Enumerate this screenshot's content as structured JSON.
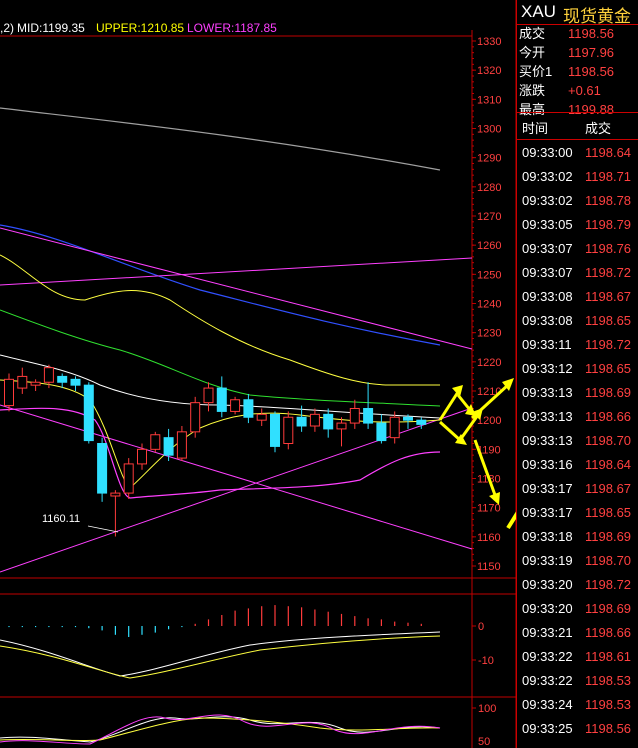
{
  "header": {
    "period_prefix": ",2)",
    "mid": "MID:1199.35",
    "upper": "UPPER:1210.85",
    "lower": "LOWER:1187.85"
  },
  "colors": {
    "up": "#ff3b3b",
    "down": "#30e0ff",
    "mid": "#ffffff",
    "upper": "#ffff00",
    "lower": "#ff00ff",
    "axis": "#c00000",
    "text_red": "#ff4040",
    "arrow": "#ffff00"
  },
  "symbol": {
    "code": "XAU",
    "name": "现货黄金"
  },
  "quote": [
    {
      "label": "成交",
      "value": "1198.56"
    },
    {
      "label": "今开",
      "value": "1197.96"
    },
    {
      "label": "买价1",
      "value": "1198.56"
    },
    {
      "label": "涨跌",
      "value": "+0.61"
    },
    {
      "label": "最高",
      "value": "1199.88"
    }
  ],
  "ticks_header": {
    "time": "时间",
    "price": "成交"
  },
  "ticks": [
    {
      "time": "09:33:00",
      "price": "1198.64"
    },
    {
      "time": "09:33:02",
      "price": "1198.71"
    },
    {
      "time": "09:33:02",
      "price": "1198.78"
    },
    {
      "time": "09:33:05",
      "price": "1198.79"
    },
    {
      "time": "09:33:07",
      "price": "1198.76"
    },
    {
      "time": "09:33:07",
      "price": "1198.72"
    },
    {
      "time": "09:33:08",
      "price": "1198.67"
    },
    {
      "time": "09:33:08",
      "price": "1198.65"
    },
    {
      "time": "09:33:11",
      "price": "1198.72"
    },
    {
      "time": "09:33:12",
      "price": "1198.65"
    },
    {
      "time": "09:33:13",
      "price": "1198.69"
    },
    {
      "time": "09:33:13",
      "price": "1198.66"
    },
    {
      "time": "09:33:13",
      "price": "1198.70"
    },
    {
      "time": "09:33:16",
      "price": "1198.64"
    },
    {
      "time": "09:33:17",
      "price": "1198.67"
    },
    {
      "time": "09:33:17",
      "price": "1198.65"
    },
    {
      "time": "09:33:18",
      "price": "1198.69"
    },
    {
      "time": "09:33:19",
      "price": "1198.70"
    },
    {
      "time": "09:33:20",
      "price": "1198.72"
    },
    {
      "time": "09:33:20",
      "price": "1198.69"
    },
    {
      "time": "09:33:21",
      "price": "1198.66"
    },
    {
      "time": "09:33:22",
      "price": "1198.61"
    },
    {
      "time": "09:33:22",
      "price": "1198.53"
    },
    {
      "time": "09:33:24",
      "price": "1198.53"
    },
    {
      "time": "09:33:25",
      "price": "1198.56"
    }
  ],
  "main_axis": {
    "labels": [
      "1330",
      "1320",
      "1310",
      "1300",
      "1290",
      "1280",
      "1270",
      "1260",
      "1250",
      "1240",
      "1230",
      "1220",
      "1210",
      "1200",
      "1190",
      "1180",
      "1170",
      "1160",
      "1150"
    ],
    "min": 1150,
    "max": 1330
  },
  "low_annotation": "1160.11",
  "macd_axis": {
    "labels": [
      "0",
      "-10"
    ]
  },
  "kdj_axis": {
    "labels": [
      "100",
      "50"
    ]
  },
  "candles": [
    {
      "o": 1205,
      "c": 1214,
      "h": 1216,
      "l": 1203
    },
    {
      "o": 1211,
      "c": 1215,
      "h": 1218,
      "l": 1209
    },
    {
      "o": 1212,
      "c": 1213,
      "h": 1214,
      "l": 1210
    },
    {
      "o": 1213,
      "c": 1218,
      "h": 1219,
      "l": 1211
    },
    {
      "o": 1215,
      "c": 1213,
      "h": 1216,
      "l": 1211
    },
    {
      "o": 1214,
      "c": 1212,
      "h": 1215,
      "l": 1210
    },
    {
      "o": 1212,
      "c": 1193,
      "h": 1213,
      "l": 1192
    },
    {
      "o": 1192,
      "c": 1175,
      "h": 1194,
      "l": 1172
    },
    {
      "o": 1174,
      "c": 1175,
      "h": 1176,
      "l": 1160.11
    },
    {
      "o": 1175,
      "c": 1185,
      "h": 1187,
      "l": 1173
    },
    {
      "o": 1185,
      "c": 1190,
      "h": 1192,
      "l": 1183
    },
    {
      "o": 1190,
      "c": 1195,
      "h": 1196,
      "l": 1189
    },
    {
      "o": 1194,
      "c": 1188,
      "h": 1197,
      "l": 1186
    },
    {
      "o": 1187,
      "c": 1196,
      "h": 1198,
      "l": 1186
    },
    {
      "o": 1196,
      "c": 1206,
      "h": 1208,
      "l": 1194
    },
    {
      "o": 1206,
      "c": 1211,
      "h": 1213,
      "l": 1203
    },
    {
      "o": 1211,
      "c": 1203,
      "h": 1215,
      "l": 1201
    },
    {
      "o": 1203,
      "c": 1207,
      "h": 1208,
      "l": 1202
    },
    {
      "o": 1207,
      "c": 1201,
      "h": 1209,
      "l": 1199
    },
    {
      "o": 1200,
      "c": 1202,
      "h": 1204,
      "l": 1198
    },
    {
      "o": 1202,
      "c": 1191,
      "h": 1203,
      "l": 1189
    },
    {
      "o": 1192,
      "c": 1201,
      "h": 1203,
      "l": 1190
    },
    {
      "o": 1201,
      "c": 1198,
      "h": 1205,
      "l": 1196
    },
    {
      "o": 1198,
      "c": 1202,
      "h": 1204,
      "l": 1196
    },
    {
      "o": 1202,
      "c": 1197,
      "h": 1204,
      "l": 1194
    },
    {
      "o": 1197,
      "c": 1199,
      "h": 1201,
      "l": 1191
    },
    {
      "o": 1199,
      "c": 1204,
      "h": 1207,
      "l": 1197
    },
    {
      "o": 1204,
      "c": 1199,
      "h": 1213,
      "l": 1197
    },
    {
      "o": 1199,
      "c": 1193,
      "h": 1202,
      "l": 1192
    },
    {
      "o": 1194,
      "c": 1201,
      "h": 1203,
      "l": 1192
    },
    {
      "o": 1201,
      "c": 1200,
      "h": 1202,
      "l": 1197
    },
    {
      "o": 1200,
      "c": 1198.56,
      "h": 1201,
      "l": 1197
    }
  ]
}
